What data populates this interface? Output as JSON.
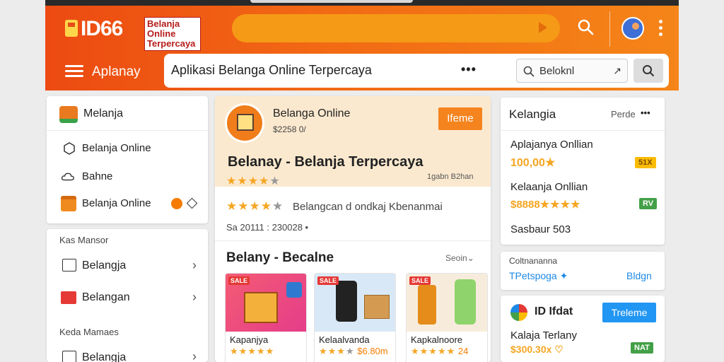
{
  "header": {
    "logo": "ID66",
    "tagline": "Belanja Online Terpercaya",
    "menu_label": "Aplanay",
    "address": "Aplikasi Belanga Online Terpercaya",
    "dots": "•••",
    "search_label": "Beloknl",
    "search_ne": "↗"
  },
  "sidebar": {
    "top_item": "Melanja",
    "items": [
      {
        "label": "Belanja Online",
        "icon": "cube-icon"
      },
      {
        "label": "Bahne",
        "icon": "cloud-icon"
      },
      {
        "label": "Belanja Online",
        "icon": "box-icon"
      }
    ],
    "section1_title": "Kas Mansor",
    "section1_items": [
      "Belangja",
      "Belangan"
    ],
    "section2_title": "Keda Mamaes",
    "section2_items": [
      "Belangja"
    ]
  },
  "main": {
    "store_name": "Belanga Online",
    "store_sub": "$2258 0/",
    "visit_button": "Ifeme",
    "title": "Belanay - Belanja Terpercaya",
    "subtitle_right": "1gabn B2han",
    "rating_stars": 4,
    "review_text": "Belangcan d ondkaj Kbenanmai",
    "stats": "Sa 20111 : 230028 •",
    "section_title": "Belany - Becalne",
    "see_all": "Seoin",
    "products": [
      {
        "name": "Kapanjya",
        "badge": "SALE",
        "price": ""
      },
      {
        "name": "Kelaalvanda",
        "badge": "SALE",
        "price": "$6.80m"
      },
      {
        "name": "Kapkalnoore",
        "badge": "SALE",
        "price": "24"
      }
    ]
  },
  "right": {
    "title": "Kelangia",
    "perde": "Perde",
    "dots": "•••",
    "rows": [
      {
        "name": "Aplajanya Onllian",
        "value": "100,00",
        "chip": "51X",
        "chip_color": "#fbbc04"
      },
      {
        "name": "Kelaanja Onllian",
        "value": "$8888",
        "chip": "RV",
        "chip_color": "#43a047"
      },
      {
        "name": "Sasbaur 503",
        "value": "",
        "chip": "",
        "chip_color": ""
      }
    ],
    "card2_title": "Coltnananna",
    "card2_link": "TPetspoga ✦",
    "card2_right": "Bldgn",
    "card3_logo": "ID Ifdat",
    "card3_button": "Treleme",
    "card3_name": "Kalaja Terlany",
    "card3_price": "$300.30x ♡",
    "card3_chip": "NAT"
  },
  "colors": {
    "accent": "#f26a14",
    "primary_blue": "#2196f3",
    "star": "#f5a623"
  }
}
